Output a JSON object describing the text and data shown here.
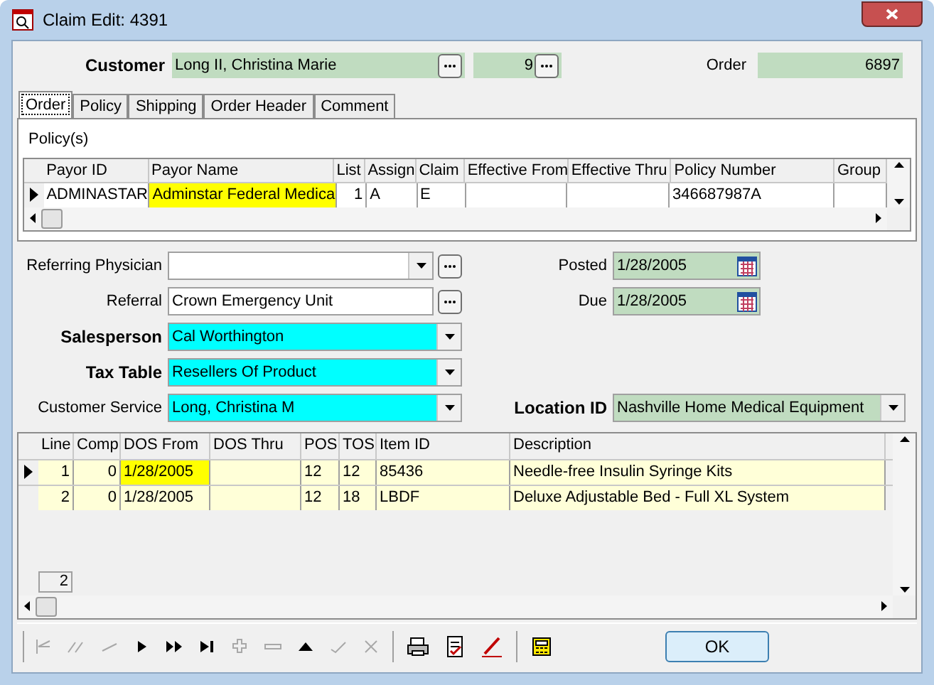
{
  "window": {
    "title": "Claim Edit: 4391"
  },
  "header": {
    "customer_label": "Customer",
    "customer_value": "Long II, Christina Marie",
    "customer_number": "9",
    "order_label": "Order",
    "order_value": "6897"
  },
  "tabs": [
    {
      "label": "Order",
      "selected": true
    },
    {
      "label": "Policy",
      "selected": false
    },
    {
      "label": "Shipping",
      "selected": false
    },
    {
      "label": "Order Header",
      "selected": false
    },
    {
      "label": "Comment",
      "selected": false
    }
  ],
  "policies": {
    "title": "Policy(s)",
    "columns": [
      "Payor ID",
      "Payor Name",
      "List",
      "Assign",
      "Claim",
      "Effective From",
      "Effective Thru",
      "Policy Number",
      "Group"
    ],
    "rows": [
      {
        "selected": true,
        "cells": [
          {
            "text": "ADMINASTAR",
            "focused": false
          },
          {
            "text": "Adminstar Federal Medica",
            "focused": true
          },
          {
            "text": "1",
            "focused": false
          },
          {
            "text": "A",
            "focused": false
          },
          {
            "text": "E",
            "focused": false
          },
          {
            "text": "",
            "focused": false
          },
          {
            "text": "",
            "focused": false
          },
          {
            "text": "346687987A",
            "focused": false
          },
          {
            "text": "",
            "focused": false
          }
        ]
      }
    ]
  },
  "left_fields": [
    {
      "label": "Referring Physician",
      "bold": false,
      "kind": "combo-lookup",
      "color": "#ffffff"
    },
    {
      "label": "Referral",
      "value": "Crown Emergency Unit",
      "bold": false,
      "kind": "lookup",
      "color": "#ffffff"
    },
    {
      "label": "Salesperson",
      "value": "Cal Worthington",
      "bold": true,
      "kind": "combo",
      "color": "#00ffff"
    },
    {
      "label": "Tax Table",
      "value": "Resellers Of Product",
      "bold": true,
      "kind": "combo",
      "color": "#00ffff"
    },
    {
      "label": "Customer Service",
      "value": "Long, Christina M",
      "bold": false,
      "kind": "combo",
      "color": "#00ffff"
    }
  ],
  "right_fields": [
    {
      "label": "Posted",
      "value": "1/28/2005",
      "bold": false,
      "kind": "date",
      "color": "#c0dcc0"
    },
    {
      "label": "Due",
      "value": "1/28/2005",
      "bold": false,
      "kind": "date",
      "color": "#c0dcc0"
    },
    {
      "label": "Location ID",
      "value": "Nashville Home Medical Equipment",
      "bold": true,
      "kind": "combo",
      "color": "#c0dcc0"
    }
  ],
  "lines": {
    "columns": [
      "Line",
      "Comp",
      "DOS From",
      "DOS Thru",
      "POS",
      "TOS",
      "Item ID",
      "Description"
    ],
    "rows": [
      {
        "selected": true,
        "cells": [
          {
            "text": "1",
            "focused": false
          },
          {
            "text": "0",
            "focused": false
          },
          {
            "text": "1/28/2005",
            "focused": true
          },
          {
            "text": "",
            "focused": false
          },
          {
            "text": "12",
            "focused": false
          },
          {
            "text": "12",
            "focused": false
          },
          {
            "text": "85436",
            "focused": false
          },
          {
            "text": "Needle-free Insulin Syringe Kits",
            "focused": false
          }
        ]
      },
      {
        "selected": false,
        "cells": [
          {
            "text": "2",
            "focused": false
          },
          {
            "text": "0",
            "focused": false
          },
          {
            "text": "1/28/2005",
            "focused": false
          },
          {
            "text": "",
            "focused": false
          },
          {
            "text": "12",
            "focused": false
          },
          {
            "text": "18",
            "focused": false
          },
          {
            "text": "LBDF",
            "focused": false
          },
          {
            "text": "Deluxe Adjustable Bed - Full XL System",
            "focused": false
          }
        ]
      }
    ],
    "count": "2"
  },
  "navigator": [
    {
      "kind": "first",
      "disabled": true
    },
    {
      "kind": "prior-page",
      "disabled": true
    },
    {
      "kind": "prior",
      "disabled": true
    },
    {
      "kind": "next",
      "disabled": false
    },
    {
      "kind": "next-page",
      "disabled": false
    },
    {
      "kind": "last",
      "disabled": false
    },
    {
      "kind": "insert",
      "disabled": true
    },
    {
      "kind": "delete",
      "disabled": true
    },
    {
      "kind": "edit",
      "disabled": false
    },
    {
      "kind": "post",
      "disabled": true
    },
    {
      "kind": "cancel",
      "disabled": true
    }
  ],
  "tools": [
    {
      "kind": "print"
    },
    {
      "kind": "report"
    },
    {
      "kind": "pen"
    },
    {
      "kind": "calculator"
    }
  ],
  "ok_button": "OK"
}
